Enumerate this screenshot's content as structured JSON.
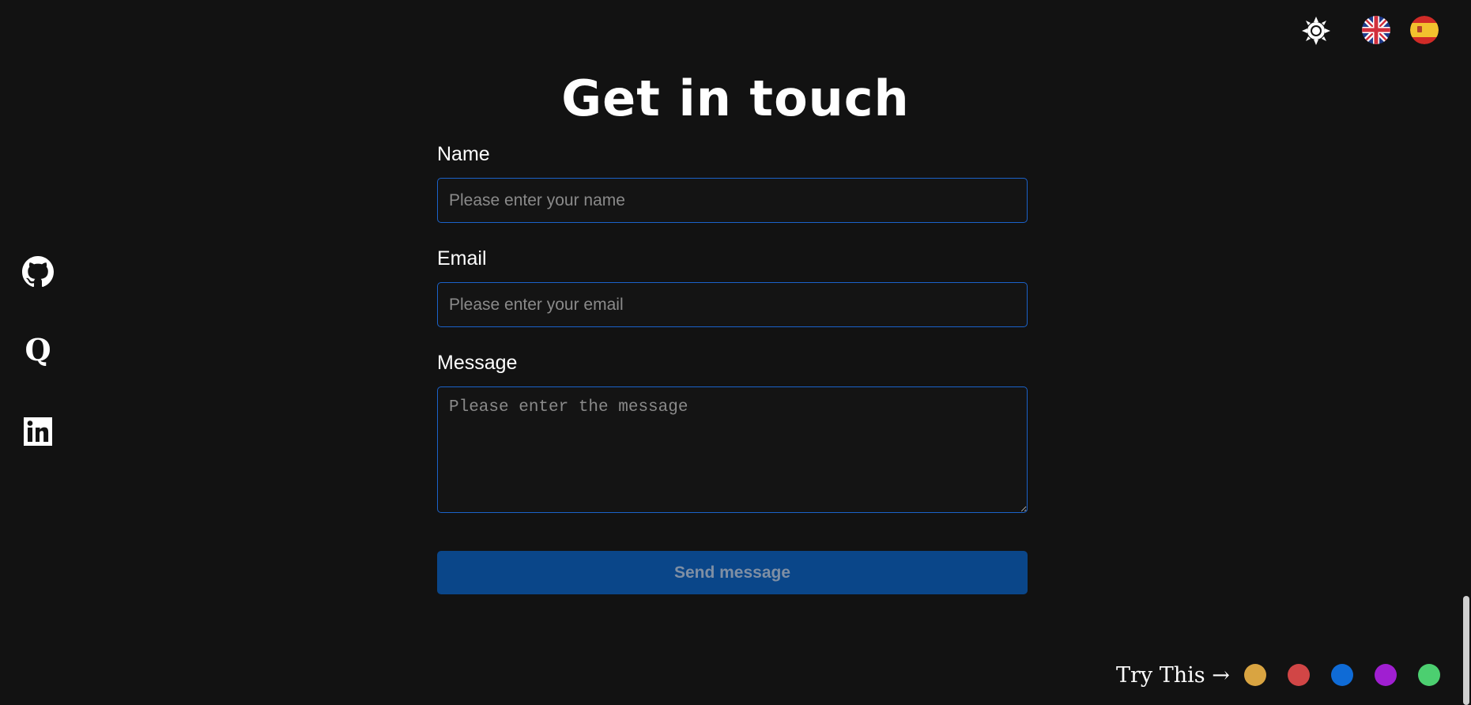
{
  "header": {
    "theme_toggle_icon": "sun-icon",
    "languages": [
      {
        "code": "en",
        "icon": "uk-flag-icon"
      },
      {
        "code": "es",
        "icon": "spain-flag-icon"
      }
    ]
  },
  "social": [
    {
      "icon": "github-icon"
    },
    {
      "icon": "quora-icon"
    },
    {
      "icon": "linkedin-icon"
    }
  ],
  "contact": {
    "title": "Get in touch",
    "name_label": "Name",
    "name_placeholder": "Please enter your name",
    "email_label": "Email",
    "email_placeholder": "Please enter your email",
    "message_label": "Message",
    "message_placeholder": "Please enter the message",
    "send_label": "Send message"
  },
  "color_picker": {
    "label": "Try This →",
    "colors": [
      "#d9a441",
      "#d14646",
      "#0f6bd6",
      "#a01fd1",
      "#4ccf70"
    ]
  },
  "colors": {
    "background": "#121212",
    "accent_border": "#1b62c9",
    "button_bg": "#0a4689",
    "button_text": "#7f8fa4"
  }
}
